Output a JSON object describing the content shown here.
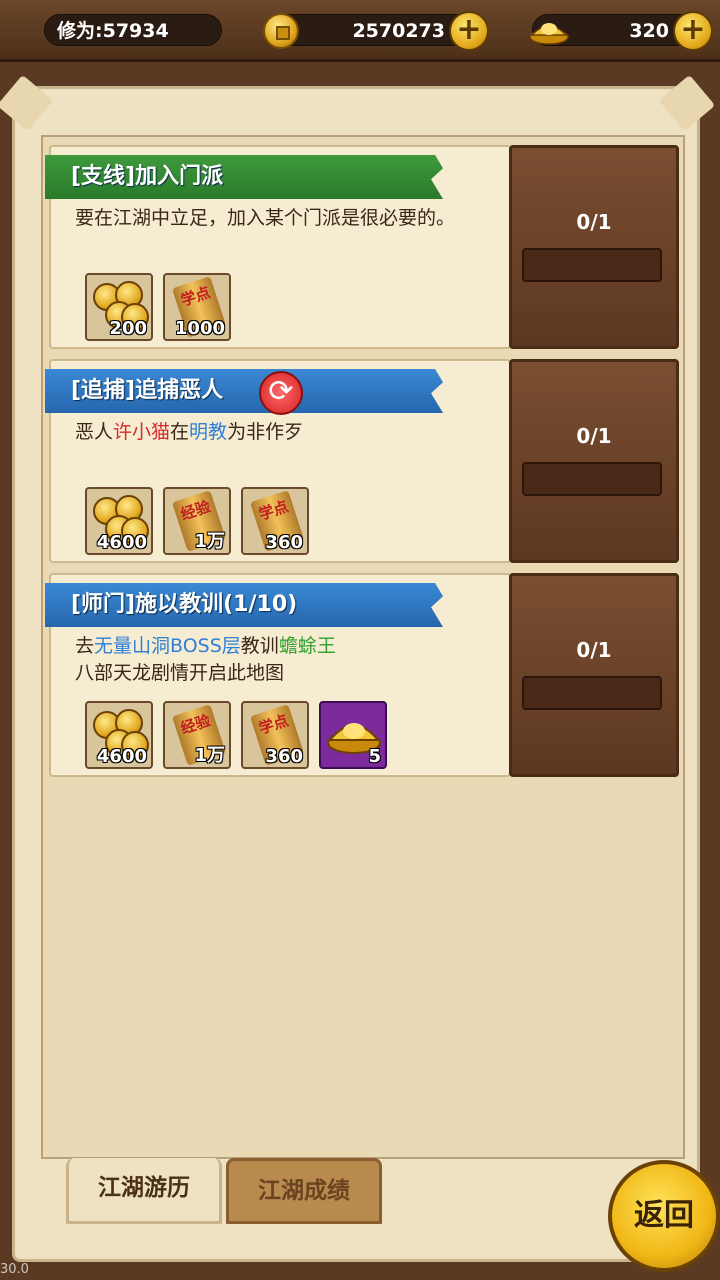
{
  "header": {
    "cultivation": "修为:57934",
    "copper": "2570273",
    "gold": "320"
  },
  "quests": [
    {
      "title": "[支线]加入门派",
      "ribbon_color": "#3f9a3c",
      "desc_parts": [
        {
          "t": "要在江湖中立足，加入某个门派是很必要的。",
          "c": ""
        }
      ],
      "progress": "0/1",
      "progress_fraction": 0,
      "rewards": [
        {
          "icon": "copper-coins-icon",
          "qty": "200"
        },
        {
          "icon": "xuedian-scroll-icon",
          "label": "学点",
          "qty": "1000"
        }
      ]
    },
    {
      "title": "[追捕]追捕恶人",
      "ribbon_color": "#3b88d4",
      "has_refresh": true,
      "desc_parts": [
        {
          "t": "恶人",
          "c": ""
        },
        {
          "t": "许小猫",
          "c": "red"
        },
        {
          "t": "在",
          "c": ""
        },
        {
          "t": "明教",
          "c": "blue"
        },
        {
          "t": "为非作歹",
          "c": ""
        }
      ],
      "progress": "0/1",
      "progress_fraction": 0,
      "rewards": [
        {
          "icon": "copper-coins-icon",
          "qty": "4600"
        },
        {
          "icon": "jingyan-scroll-icon",
          "label": "经验",
          "qty": "1万"
        },
        {
          "icon": "xuedian-scroll-icon",
          "label": "学点",
          "qty": "360"
        }
      ]
    },
    {
      "title": "[师门]施以教训(1/10)",
      "ribbon_color": "#3b88d4",
      "desc_parts": [
        {
          "t": "去",
          "c": ""
        },
        {
          "t": "无量山洞BOSS层",
          "c": "blue"
        },
        {
          "t": "教训",
          "c": ""
        },
        {
          "t": "蟾蜍王",
          "c": "green"
        },
        {
          "t": "\n八部天龙剧情开启此地图",
          "c": ""
        }
      ],
      "progress": "0/1",
      "progress_fraction": 0,
      "rewards": [
        {
          "icon": "copper-coins-icon",
          "qty": "4600"
        },
        {
          "icon": "jingyan-scroll-icon",
          "label": "经验",
          "qty": "1万"
        },
        {
          "icon": "xuedian-scroll-icon",
          "label": "学点",
          "qty": "360"
        },
        {
          "icon": "gold-ingot-icon",
          "qty": "5",
          "rare": true
        }
      ]
    }
  ],
  "tabs": {
    "active": "江湖游历",
    "inactive": "江湖成绩"
  },
  "back_button": "返回",
  "fps": "30.0",
  "colors": {
    "panel": "#efe2c3",
    "progress_panel": "#6b4329",
    "green_ribbon": "#3f9a3c",
    "blue_ribbon": "#3b88d4",
    "red_text": "#d42a2a",
    "blue_text": "#2f7fd6",
    "green_text": "#2fa02f"
  }
}
